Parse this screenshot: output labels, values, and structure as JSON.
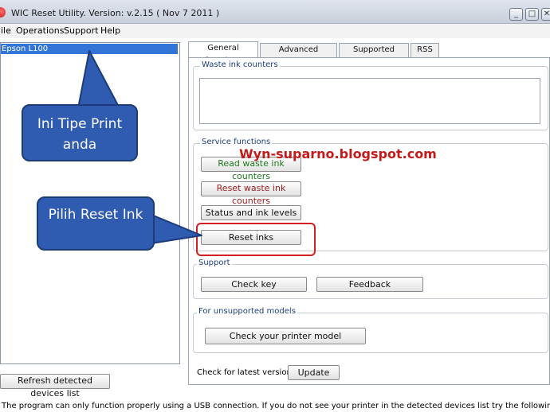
{
  "window": {
    "title": "WIC Reset Utility. Version: v.2.15 ( Nov  7 2011 )",
    "minimize_glyph": "_",
    "maximize_glyph": "□",
    "close_glyph": "✕"
  },
  "menu": [
    "ile",
    "Operations",
    "Support",
    "Help"
  ],
  "devices": {
    "selected": "Epson L100",
    "refresh_label": "Refresh detected devices list"
  },
  "tabs": [
    {
      "label": "General functions",
      "active": true
    },
    {
      "label": "Advanced functions",
      "active": false
    },
    {
      "label": "Supported models",
      "active": false
    },
    {
      "label": "RSS",
      "active": false
    }
  ],
  "groups": {
    "waste_ink": "Waste ink counters",
    "service": "Service functions",
    "support": "Support",
    "unsupported": "For unsupported models"
  },
  "buttons": {
    "read_waste": "Read waste ink counters",
    "reset_waste": "Reset waste ink counters",
    "status_levels": "Status and ink levels",
    "reset_inks": "Reset inks",
    "check_key": "Check key",
    "feedback": "Feedback",
    "check_model": "Check your printer model",
    "update": "Update"
  },
  "latest_version_label": "Check for latest version",
  "annotations": {
    "callout_printer": "Ini Tipe Print anda",
    "callout_reset": "Pilih Reset Ink",
    "watermark": "Wyn-suparno.blogspot.com"
  },
  "status_message": "The program can only function properly using a USB connection. If you do not see your printer in the detected devices list try the following:",
  "colors": {
    "selection": "#3375d6",
    "callout": "#2f5bb0",
    "highlight": "#d21f1f",
    "watermark": "#c41a1a",
    "read_button_text": "#1b7a1b",
    "reset_button_text": "#9b1c1c"
  }
}
